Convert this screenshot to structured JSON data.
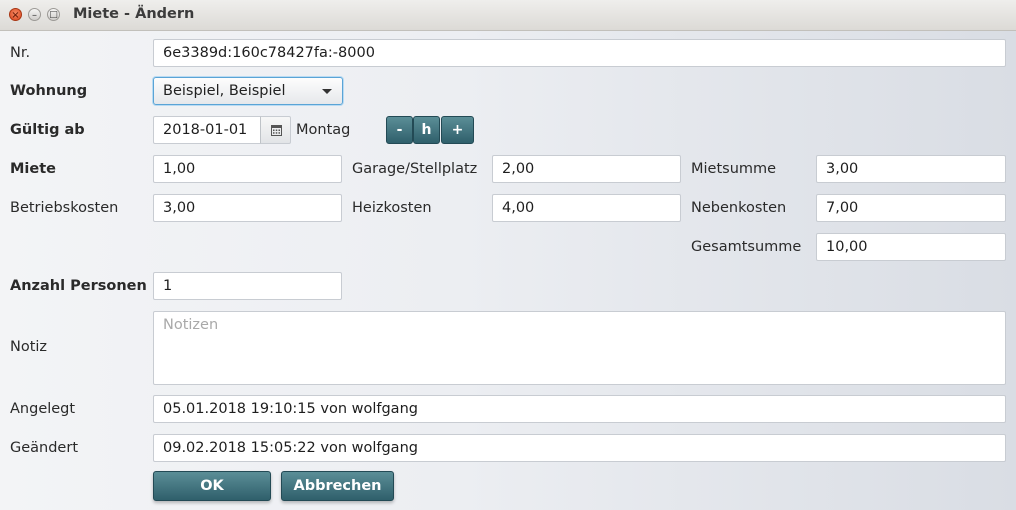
{
  "window": {
    "title": "Miete - Ändern",
    "controls": {
      "close": "×",
      "minimize": "–",
      "maximize": "□"
    }
  },
  "form": {
    "nr": {
      "label": "Nr.",
      "value": "6e3389d:160c78427fa:-8000"
    },
    "wohnung": {
      "label": "Wohnung",
      "value": "Beispiel, Beispiel"
    },
    "gueltig_ab": {
      "label": "Gültig ab",
      "value": "2018-01-01",
      "weekday": "Montag",
      "buttons": {
        "minus": "-",
        "today": "h",
        "plus": "+"
      }
    },
    "miete": {
      "label": "Miete",
      "value": "1,00"
    },
    "garage": {
      "label": "Garage/Stellplatz",
      "value": "2,00"
    },
    "mietsumme": {
      "label": "Mietsumme",
      "value": "3,00"
    },
    "betriebskosten": {
      "label": "Betriebskosten",
      "value": "3,00"
    },
    "heizkosten": {
      "label": "Heizkosten",
      "value": "4,00"
    },
    "nebenkosten": {
      "label": "Nebenkosten",
      "value": "7,00"
    },
    "gesamtsumme": {
      "label": "Gesamtsumme",
      "value": "10,00"
    },
    "anzahl_personen": {
      "label": "Anzahl Personen",
      "value": "1"
    },
    "notiz": {
      "label": "Notiz",
      "placeholder": "Notizen",
      "value": ""
    },
    "angelegt": {
      "label": "Angelegt",
      "value": "05.01.2018 19:10:15 von wolfgang"
    },
    "geaendert": {
      "label": "Geändert",
      "value": "09.02.2018 15:05:22 von wolfgang"
    }
  },
  "actions": {
    "ok": "OK",
    "cancel": "Abbrechen"
  },
  "colors": {
    "button_top": "#5b8e97",
    "button_bottom": "#2f5f6b",
    "focus_border": "#5aa4d6",
    "close_button": "#e05a2e"
  }
}
